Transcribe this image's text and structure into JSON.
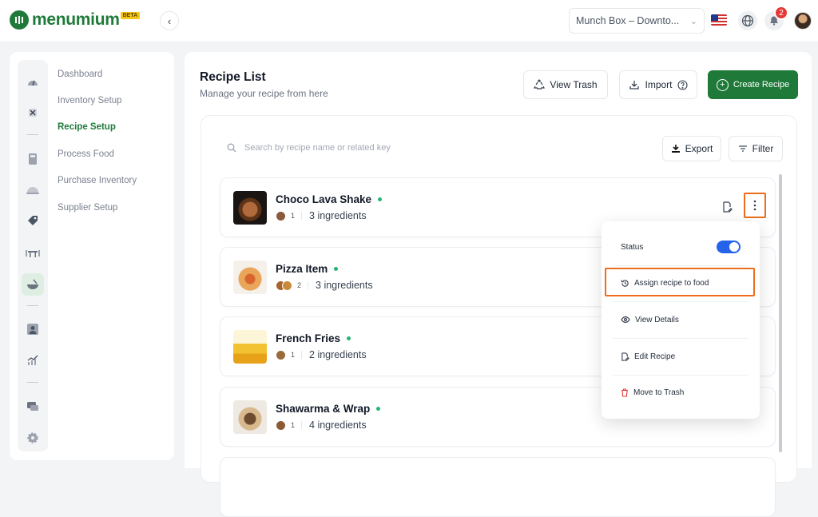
{
  "brand": {
    "name": "menumium",
    "beta": "BETA"
  },
  "header": {
    "branch": "Munch Box – Downto...",
    "notification_count": "2"
  },
  "sidebar": {
    "items": [
      {
        "label": "Dashboard"
      },
      {
        "label": "Inventory Setup"
      },
      {
        "label": "Recipe Setup",
        "active": true
      },
      {
        "label": "Process Food"
      },
      {
        "label": "Purchase Inventory"
      },
      {
        "label": "Supplier Setup"
      }
    ]
  },
  "page": {
    "title": "Recipe List",
    "subtitle": "Manage your recipe from here",
    "view_trash": "View Trash",
    "import": "Import",
    "create": "Create Recipe"
  },
  "toolbar": {
    "search_placeholder": "Search by recipe name or related key",
    "export": "Export",
    "filter": "Filter"
  },
  "recipes": [
    {
      "name": "Choco Lava Shake",
      "count": "1",
      "ingredients": "3 ingredients"
    },
    {
      "name": "Pizza Item",
      "count": "2",
      "ingredients": "3 ingredients"
    },
    {
      "name": "French Fries",
      "count": "1",
      "ingredients": "2 ingredients"
    },
    {
      "name": "Shawarma & Wrap",
      "count": "1",
      "ingredients": "4 ingredients"
    }
  ],
  "menu": {
    "status": "Status",
    "status_on": true,
    "assign": "Assign recipe to food",
    "view": "View Details",
    "edit": "Edit Recipe",
    "trash": "Move to Trash"
  },
  "colors": {
    "brand_green": "#1f7a3a",
    "highlight": "#ec6d1a",
    "toggle": "#2563eb",
    "status_dot": "#22b573"
  }
}
